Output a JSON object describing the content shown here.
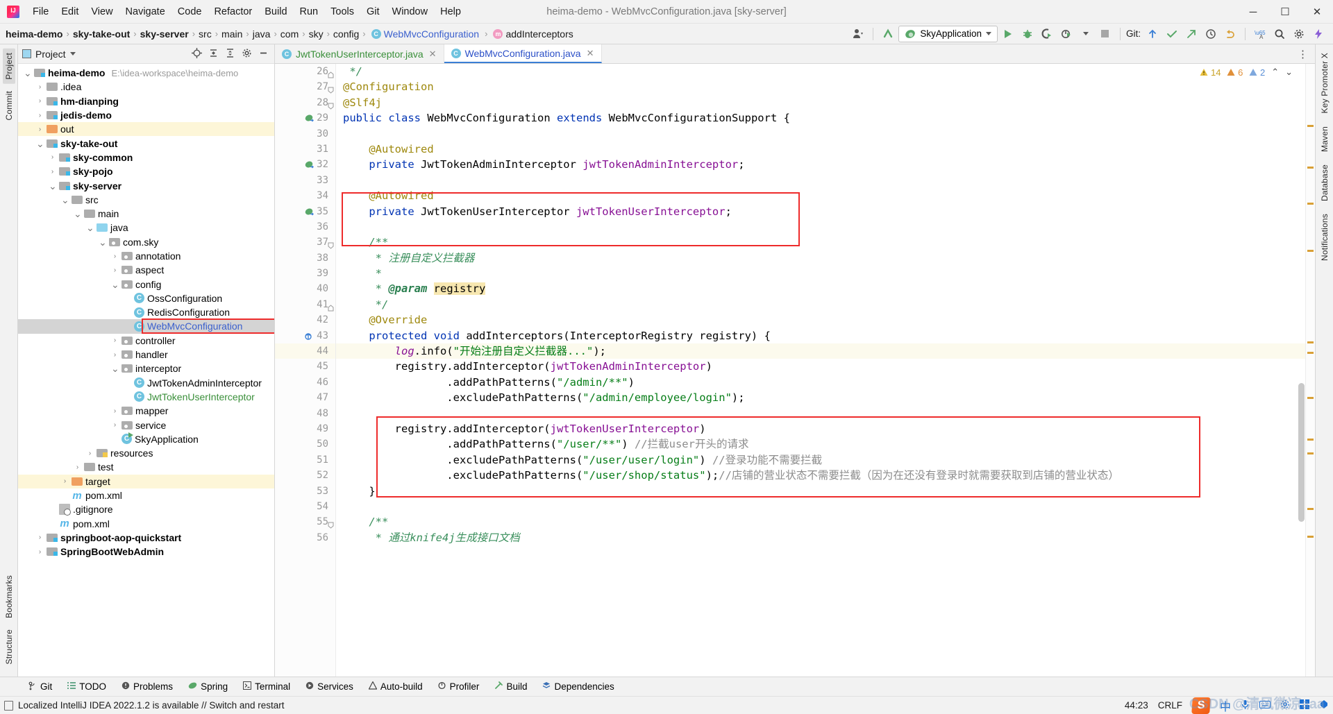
{
  "window": {
    "title": "heima-demo - WebMvcConfiguration.java [sky-server]",
    "minimize": "─",
    "maximize": "☐",
    "close": "✕"
  },
  "menu": {
    "items": [
      "File",
      "Edit",
      "View",
      "Navigate",
      "Code",
      "Refactor",
      "Build",
      "Run",
      "Tools",
      "Git",
      "Window",
      "Help"
    ]
  },
  "breadcrumb": {
    "items": [
      {
        "label": "heima-demo",
        "style": "bold"
      },
      {
        "label": "sky-take-out",
        "style": "bold"
      },
      {
        "label": "sky-server",
        "style": "bold"
      },
      {
        "label": "src",
        "style": "plain"
      },
      {
        "label": "main",
        "style": "plain"
      },
      {
        "label": "java",
        "style": "plain"
      },
      {
        "label": "com",
        "style": "plain"
      },
      {
        "label": "sky",
        "style": "plain"
      },
      {
        "label": "config",
        "style": "plain"
      },
      {
        "label": "WebMvcConfiguration",
        "style": "class",
        "icon": "C"
      },
      {
        "label": "addInterceptors",
        "style": "method",
        "icon": "m"
      }
    ],
    "separator": "›"
  },
  "toolbar": {
    "run_config": "SkyApplication",
    "run_config_caret": "▼",
    "git_label": "Git:",
    "icons": {
      "profile": "user-profile-icon",
      "updates": "update-arrow-icon",
      "run": "run-icon",
      "debug": "debug-icon",
      "coverage": "run-coverage-icon",
      "profiler": "profiler-icon",
      "stop": "stop-icon",
      "git_update": "git-update-icon",
      "git_commit": "git-commit-icon",
      "git_push": "git-push-icon",
      "history": "history-icon",
      "undo": "undo-icon",
      "translate": "translate-icon",
      "search": "search-icon",
      "settings": "settings-icon",
      "boost": "boost-icon"
    }
  },
  "left_rail": {
    "items": [
      "Project",
      "Commit",
      "Bookmarks",
      "Structure"
    ]
  },
  "right_rail": {
    "items": [
      "Key Promoter X",
      "Maven",
      "Database",
      "Notifications"
    ]
  },
  "project_panel": {
    "title": "Project",
    "title_caret": "▼",
    "header_icons": [
      "locate-icon",
      "collapse-all-icon",
      "expand-all-icon",
      "settings-icon",
      "hide-icon"
    ],
    "tree": [
      {
        "indent": 0,
        "arrow": "v",
        "icon": "module",
        "label": "heima-demo",
        "bold": true,
        "note": "E:\\idea-workspace\\heima-demo"
      },
      {
        "indent": 1,
        "arrow": ">",
        "icon": "folder",
        "label": ".idea"
      },
      {
        "indent": 1,
        "arrow": ">",
        "icon": "module",
        "label": "hm-dianping",
        "bold": true
      },
      {
        "indent": 1,
        "arrow": ">",
        "icon": "module",
        "label": "jedis-demo",
        "bold": true
      },
      {
        "indent": 1,
        "arrow": ">",
        "icon": "folder-orange",
        "label": "out",
        "highlight": true
      },
      {
        "indent": 1,
        "arrow": "v",
        "icon": "module",
        "label": "sky-take-out",
        "bold": true
      },
      {
        "indent": 2,
        "arrow": ">",
        "icon": "module",
        "label": "sky-common",
        "bold": true
      },
      {
        "indent": 2,
        "arrow": ">",
        "icon": "module",
        "label": "sky-pojo",
        "bold": true
      },
      {
        "indent": 2,
        "arrow": "v",
        "icon": "module",
        "label": "sky-server",
        "bold": true
      },
      {
        "indent": 3,
        "arrow": "v",
        "icon": "folder",
        "label": "src"
      },
      {
        "indent": 4,
        "arrow": "v",
        "icon": "folder",
        "label": "main"
      },
      {
        "indent": 5,
        "arrow": "v",
        "icon": "folder-blue",
        "label": "java"
      },
      {
        "indent": 6,
        "arrow": "v",
        "icon": "package",
        "label": "com.sky"
      },
      {
        "indent": 7,
        "arrow": ">",
        "icon": "package",
        "label": "annotation"
      },
      {
        "indent": 7,
        "arrow": ">",
        "icon": "package",
        "label": "aspect"
      },
      {
        "indent": 7,
        "arrow": "v",
        "icon": "package",
        "label": "config"
      },
      {
        "indent": 8,
        "arrow": "",
        "icon": "class",
        "label": "OssConfiguration"
      },
      {
        "indent": 8,
        "arrow": "",
        "icon": "class",
        "label": "RedisConfiguration"
      },
      {
        "indent": 8,
        "arrow": "",
        "icon": "class",
        "label": "WebMvcConfiguration",
        "selected": true,
        "color": "blue",
        "boxed": true
      },
      {
        "indent": 7,
        "arrow": ">",
        "icon": "package",
        "label": "controller"
      },
      {
        "indent": 7,
        "arrow": ">",
        "icon": "package",
        "label": "handler"
      },
      {
        "indent": 7,
        "arrow": "v",
        "icon": "package",
        "label": "interceptor"
      },
      {
        "indent": 8,
        "arrow": "",
        "icon": "class",
        "label": "JwtTokenAdminInterceptor"
      },
      {
        "indent": 8,
        "arrow": "",
        "icon": "class",
        "label": "JwtTokenUserInterceptor",
        "color": "green"
      },
      {
        "indent": 7,
        "arrow": ">",
        "icon": "package",
        "label": "mapper"
      },
      {
        "indent": 7,
        "arrow": ">",
        "icon": "package",
        "label": "service"
      },
      {
        "indent": 7,
        "arrow": "",
        "icon": "spring-app",
        "label": "SkyApplication"
      },
      {
        "indent": 5,
        "arrow": ">",
        "icon": "resources",
        "label": "resources"
      },
      {
        "indent": 4,
        "arrow": ">",
        "icon": "folder",
        "label": "test"
      },
      {
        "indent": 3,
        "arrow": ">",
        "icon": "folder-orange",
        "label": "target",
        "highlight": true
      },
      {
        "indent": 3,
        "arrow": "",
        "icon": "maven",
        "label": "pom.xml"
      },
      {
        "indent": 2,
        "arrow": "",
        "icon": "gitignore",
        "label": ".gitignore"
      },
      {
        "indent": 2,
        "arrow": "",
        "icon": "maven",
        "label": "pom.xml"
      },
      {
        "indent": 1,
        "arrow": ">",
        "icon": "module",
        "label": "springboot-aop-quickstart",
        "bold": true
      },
      {
        "indent": 1,
        "arrow": ">",
        "icon": "module",
        "label": "SpringBootWebAdmin",
        "bold": true
      }
    ]
  },
  "editor": {
    "tabs": [
      {
        "label": "JwtTokenUserInterceptor.java",
        "icon": "C",
        "color": "green",
        "active": false,
        "close": "✕"
      },
      {
        "label": "WebMvcConfiguration.java",
        "icon": "C",
        "color": "blue",
        "active": true,
        "close": "✕"
      }
    ],
    "more_icon": "⋮",
    "inspection_summary": {
      "warnings": "14",
      "weak_warnings": "6",
      "grammar": "2",
      "collapse": "⌃",
      "expand": "⌄"
    },
    "first_line_number": 26,
    "code_lines": [
      {
        "n": 26,
        "tokens": [
          {
            "t": " */",
            "c": "jd"
          }
        ],
        "fold": "end"
      },
      {
        "n": 27,
        "tokens": [
          {
            "t": "@Configuration",
            "c": "an"
          }
        ],
        "fold": "start"
      },
      {
        "n": 28,
        "tokens": [
          {
            "t": "@Slf4j",
            "c": "an"
          }
        ],
        "fold": "start"
      },
      {
        "n": 29,
        "tokens": [
          {
            "t": "public",
            "c": "kw"
          },
          {
            "t": " ",
            "c": "id"
          },
          {
            "t": "class",
            "c": "kw"
          },
          {
            "t": " ",
            "c": "id"
          },
          {
            "t": "WebMvcConfiguration",
            "c": "id"
          },
          {
            "t": " ",
            "c": "id"
          },
          {
            "t": "extends",
            "c": "kw"
          },
          {
            "t": " WebMvcConfigurationSupport {",
            "c": "id"
          }
        ],
        "gmark": "spring-bean"
      },
      {
        "n": 30,
        "tokens": []
      },
      {
        "n": 31,
        "tokens": [
          {
            "t": "    ",
            "c": "id"
          },
          {
            "t": "@Autowired",
            "c": "an"
          }
        ]
      },
      {
        "n": 32,
        "tokens": [
          {
            "t": "    ",
            "c": "id"
          },
          {
            "t": "private",
            "c": "kw"
          },
          {
            "t": " JwtTokenAdminInterceptor ",
            "c": "id"
          },
          {
            "t": "jwtTokenAdminInterceptor",
            "c": "fld"
          },
          {
            "t": ";",
            "c": "id"
          }
        ],
        "gmark": "spring-autowire"
      },
      {
        "n": 33,
        "tokens": []
      },
      {
        "n": 34,
        "tokens": [
          {
            "t": "    ",
            "c": "id"
          },
          {
            "t": "@Autowired",
            "c": "an"
          }
        ]
      },
      {
        "n": 35,
        "tokens": [
          {
            "t": "    ",
            "c": "id"
          },
          {
            "t": "private",
            "c": "kw"
          },
          {
            "t": " JwtTokenUserInterceptor ",
            "c": "id"
          },
          {
            "t": "jwtTokenUserInterceptor",
            "c": "fld"
          },
          {
            "t": ";",
            "c": "id"
          }
        ],
        "gmark": "spring-autowire"
      },
      {
        "n": 36,
        "tokens": []
      },
      {
        "n": 37,
        "tokens": [
          {
            "t": "    /**",
            "c": "jd"
          }
        ],
        "fold": "start"
      },
      {
        "n": 38,
        "tokens": [
          {
            "t": "     * ",
            "c": "jd"
          },
          {
            "t": "注册自定义拦截器",
            "c": "jd"
          }
        ]
      },
      {
        "n": 39,
        "tokens": [
          {
            "t": "     *",
            "c": "jd"
          }
        ]
      },
      {
        "n": 40,
        "tokens": [
          {
            "t": "     * ",
            "c": "jd"
          },
          {
            "t": "@param",
            "c": "jdt"
          },
          {
            "t": " ",
            "c": "jd"
          },
          {
            "t": "registry",
            "c": "hlparam"
          }
        ]
      },
      {
        "n": 41,
        "tokens": [
          {
            "t": "     */",
            "c": "jd"
          }
        ],
        "fold": "end"
      },
      {
        "n": 42,
        "tokens": [
          {
            "t": "    ",
            "c": "id"
          },
          {
            "t": "@Override",
            "c": "an"
          }
        ]
      },
      {
        "n": 43,
        "tokens": [
          {
            "t": "    ",
            "c": "id"
          },
          {
            "t": "protected",
            "c": "kw"
          },
          {
            "t": " ",
            "c": "id"
          },
          {
            "t": "void",
            "c": "kw"
          },
          {
            "t": " addInterceptors(InterceptorRegistry registry) {",
            "c": "id"
          }
        ],
        "gmark": "override"
      },
      {
        "n": 44,
        "tokens": [
          {
            "t": "        ",
            "c": "id"
          },
          {
            "t": "log",
            "c": "stat"
          },
          {
            "t": ".info(",
            "c": "id"
          },
          {
            "t": "\"开始注册自定义拦截器...\"",
            "c": "str"
          },
          {
            "t": ");",
            "c": "id"
          }
        ],
        "current": true
      },
      {
        "n": 45,
        "tokens": [
          {
            "t": "        registry.addInterceptor(",
            "c": "id"
          },
          {
            "t": "jwtTokenAdminInterceptor",
            "c": "fld"
          },
          {
            "t": ")",
            "c": "id"
          }
        ]
      },
      {
        "n": 46,
        "tokens": [
          {
            "t": "                .addPathPatterns(",
            "c": "id"
          },
          {
            "t": "\"/admin/**\"",
            "c": "str"
          },
          {
            "t": ")",
            "c": "id"
          }
        ]
      },
      {
        "n": 47,
        "tokens": [
          {
            "t": "                .excludePathPatterns(",
            "c": "id"
          },
          {
            "t": "\"/admin/employee/login\"",
            "c": "str"
          },
          {
            "t": ");",
            "c": "id"
          }
        ]
      },
      {
        "n": 48,
        "tokens": []
      },
      {
        "n": 49,
        "tokens": [
          {
            "t": "        registry.addInterceptor(",
            "c": "id"
          },
          {
            "t": "jwtTokenUserInterceptor",
            "c": "fld"
          },
          {
            "t": ")",
            "c": "id"
          }
        ]
      },
      {
        "n": 50,
        "tokens": [
          {
            "t": "                .addPathPatterns(",
            "c": "id"
          },
          {
            "t": "\"/user/**\"",
            "c": "str"
          },
          {
            "t": ") ",
            "c": "id"
          },
          {
            "t": "//拦截user开头的请求",
            "c": "cm"
          }
        ]
      },
      {
        "n": 51,
        "tokens": [
          {
            "t": "                .excludePathPatterns(",
            "c": "id"
          },
          {
            "t": "\"/user/user/login\"",
            "c": "str"
          },
          {
            "t": ") ",
            "c": "id"
          },
          {
            "t": "//登录功能不需要拦截",
            "c": "cm"
          }
        ]
      },
      {
        "n": 52,
        "tokens": [
          {
            "t": "                .excludePathPatterns(",
            "c": "id"
          },
          {
            "t": "\"/user/shop/status\"",
            "c": "str"
          },
          {
            "t": ");",
            "c": "id"
          },
          {
            "t": "//店铺的营业状态不需要拦截（因为在还没有登录时就需要获取到店铺的营业状态）",
            "c": "cm"
          }
        ]
      },
      {
        "n": 53,
        "tokens": [
          {
            "t": "    }",
            "c": "id"
          }
        ]
      },
      {
        "n": 54,
        "tokens": []
      },
      {
        "n": 55,
        "tokens": [
          {
            "t": "    /**",
            "c": "jd"
          }
        ],
        "fold": "start"
      },
      {
        "n": 56,
        "tokens": [
          {
            "t": "     * ",
            "c": "jd"
          },
          {
            "t": "通过knife4j生成接口文档",
            "c": "jd"
          }
        ]
      }
    ]
  },
  "bottom_toolbar": {
    "items": [
      {
        "label": "Git",
        "icon": "git-branch-icon"
      },
      {
        "label": "TODO",
        "icon": "todo-list-icon"
      },
      {
        "label": "Problems",
        "icon": "problems-icon"
      },
      {
        "label": "Spring",
        "icon": "spring-leaf-icon"
      },
      {
        "label": "Terminal",
        "icon": "terminal-icon"
      },
      {
        "label": "Services",
        "icon": "services-icon"
      },
      {
        "label": "Auto-build",
        "icon": "auto-build-icon"
      },
      {
        "label": "Profiler",
        "icon": "profiler-icon"
      },
      {
        "label": "Build",
        "icon": "build-hammer-icon"
      },
      {
        "label": "Dependencies",
        "icon": "dependencies-icon"
      }
    ]
  },
  "status_bar": {
    "notification": "Localized IntelliJ IDEA 2022.1.2 is available // Switch and restart",
    "caret_position": "44:23",
    "line_separator": "CRLF",
    "ime_label": "中",
    "sogou_logo": "S",
    "watermark": "CSDN @清风微凉aaa"
  },
  "colors": {
    "accent_blue": "#3a7fd5",
    "highlight_red": "#ee2b2b",
    "green_run": "#59a869",
    "selection_gray": "#d4d4d4",
    "current_line": "#fcfaed"
  }
}
